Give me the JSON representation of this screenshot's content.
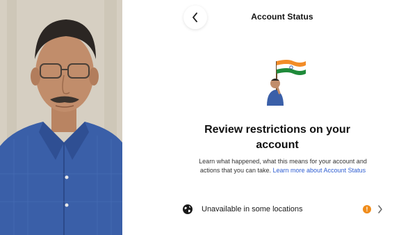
{
  "header": {
    "title": "Account Status",
    "back_icon": "chevron-left-icon"
  },
  "status_graphic": {
    "icon": "flag-waving-person-sticker"
  },
  "main": {
    "headline": "Review restrictions on your account",
    "description": "Learn what happened, what this means for your account and actions that you can take.",
    "link_text": "Learn more about Account Status"
  },
  "status_row": {
    "icon": "globe-icon",
    "label": "Unavailable in some locations",
    "alert_icon": "exclamation-icon",
    "alert_glyph": "!",
    "chevron_icon": "chevron-right-icon"
  },
  "colors": {
    "link": "#2f5ed1",
    "alert": "#f08c1a",
    "shirt": "#3a5fa8"
  }
}
